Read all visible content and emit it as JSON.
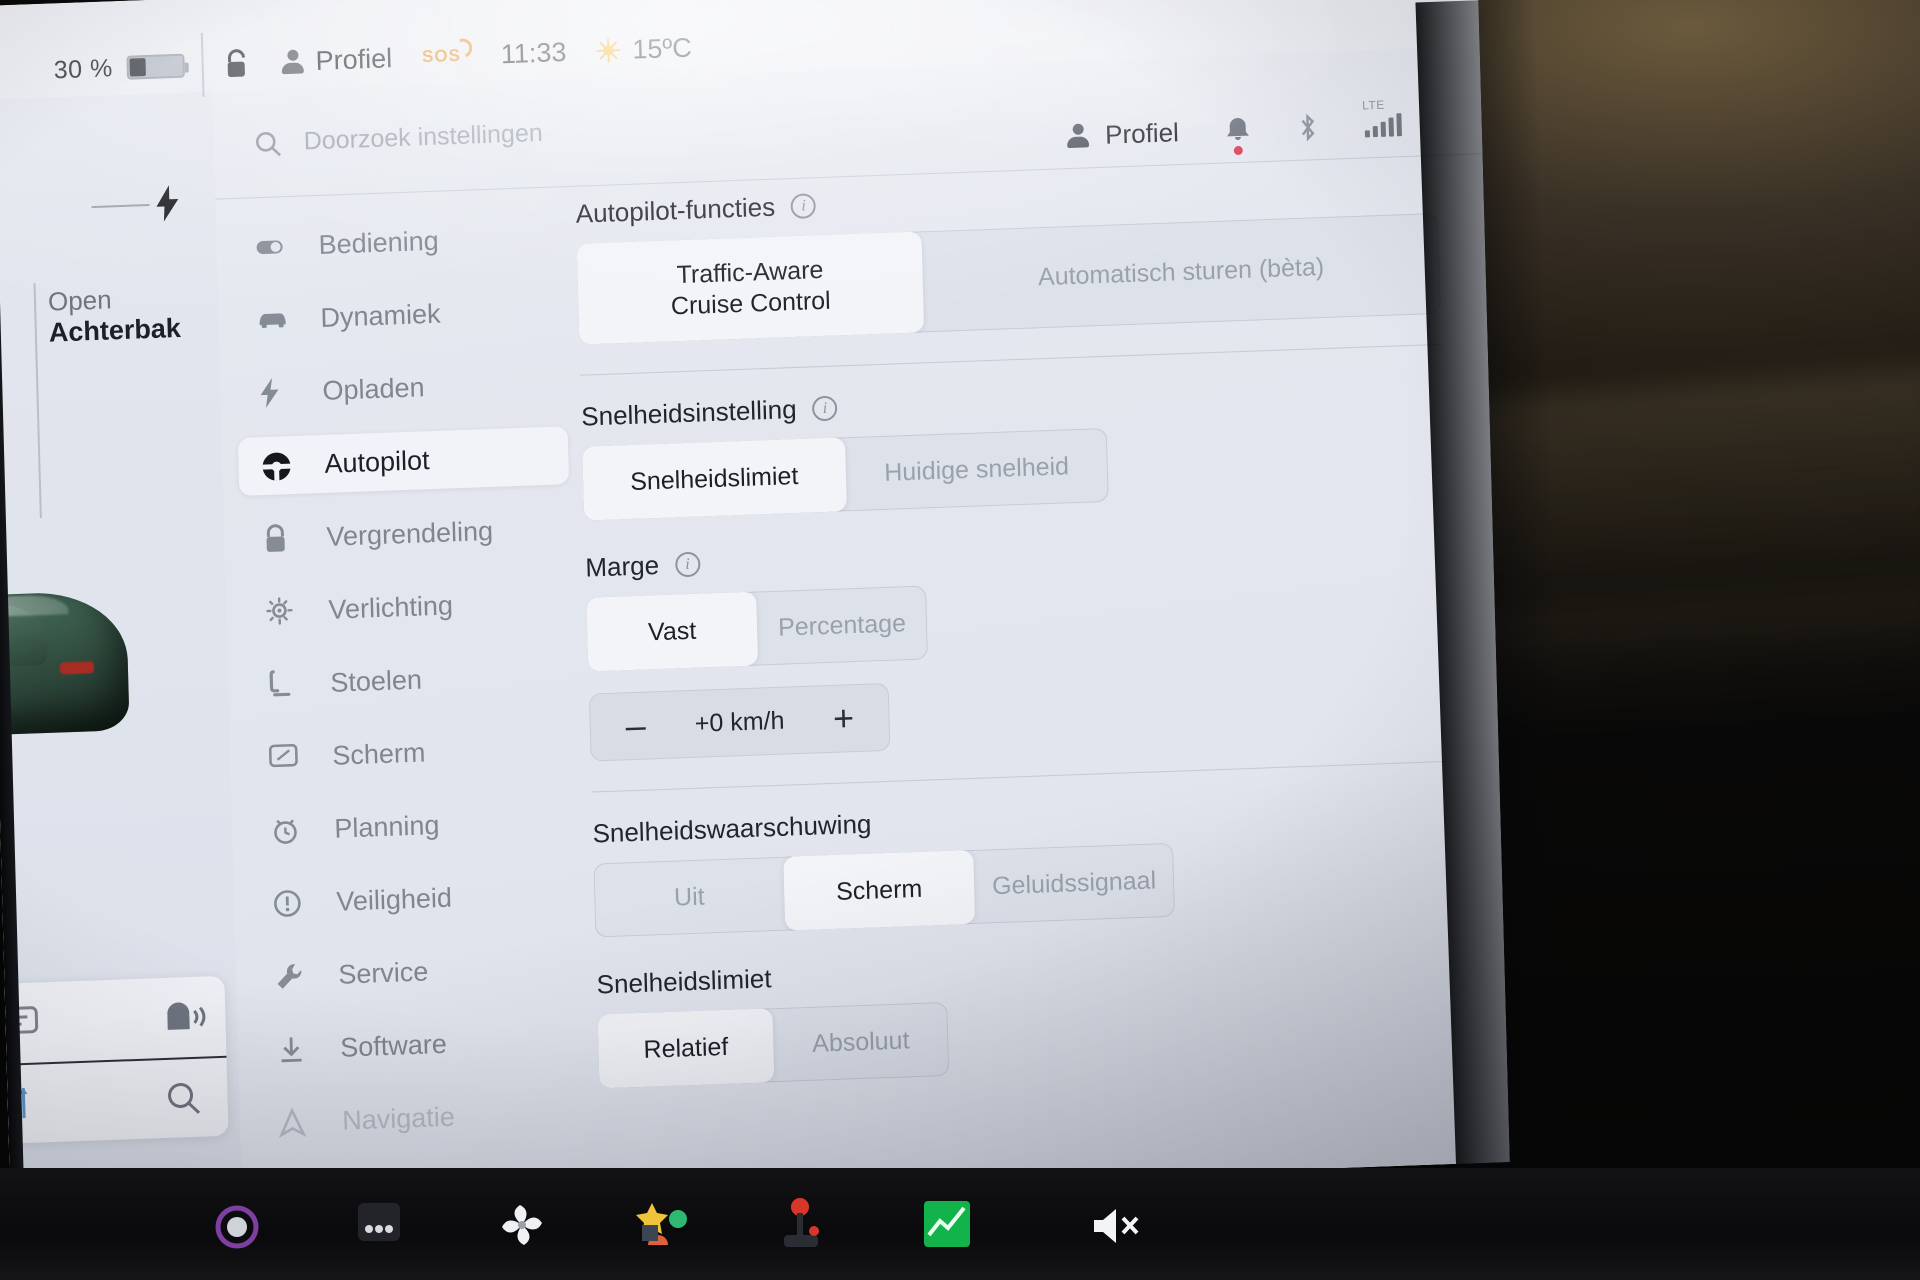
{
  "statusbar": {
    "battery_percent": "30 %",
    "battery_level": 30,
    "lock_icon": "unlock-icon",
    "profile_label": "Profiel",
    "sos_label": "SOS",
    "time": "11:33",
    "weather_icon": "sun-icon",
    "temperature": "15ºC"
  },
  "left_panel": {
    "action_line1": "Open",
    "action_line2": "Achterbak",
    "car_icon": "tesla-car-render",
    "charge_icon": "lightning-bolt-icon",
    "card": {
      "voice_icon": "voice-assistant-icon",
      "list_icon": "list-icon",
      "search_icon": "search-icon",
      "slider_icon": "slider-icon"
    }
  },
  "settings": {
    "search": {
      "placeholder": "Doorzoek instellingen",
      "value": "",
      "icon": "search-icon"
    },
    "topbar": {
      "profile_label": "Profiel",
      "profile_icon": "person-icon",
      "bell_icon": "bell-icon",
      "bell_has_badge": true,
      "bluetooth_icon": "bluetooth-icon",
      "network_label": "LTE",
      "network_icon": "signal-bars-icon"
    },
    "nav": {
      "items": [
        {
          "label": "Bediening",
          "icon": "toggle-icon",
          "selected": false
        },
        {
          "label": "Dynamiek",
          "icon": "car-icon",
          "selected": false
        },
        {
          "label": "Opladen",
          "icon": "lightning-icon",
          "selected": false
        },
        {
          "label": "Autopilot",
          "icon": "steering-wheel-icon",
          "selected": true
        },
        {
          "label": "Vergrendeling",
          "icon": "lock-icon",
          "selected": false
        },
        {
          "label": "Verlichting",
          "icon": "bulb-icon",
          "selected": false
        },
        {
          "label": "Stoelen",
          "icon": "seat-icon",
          "selected": false
        },
        {
          "label": "Scherm",
          "icon": "display-icon",
          "selected": false
        },
        {
          "label": "Planning",
          "icon": "clock-icon",
          "selected": false
        },
        {
          "label": "Veiligheid",
          "icon": "warning-icon",
          "selected": false
        },
        {
          "label": "Service",
          "icon": "wrench-icon",
          "selected": false
        },
        {
          "label": "Software",
          "icon": "download-icon",
          "selected": false
        },
        {
          "label": "Navigatie",
          "icon": "navigation-icon",
          "selected": false
        }
      ]
    },
    "sections": {
      "autopilot_functions": {
        "title": "Autopilot-functies",
        "has_info": true,
        "options": [
          "Traffic-Aware\nCruise Control",
          "Automatisch sturen (bèta)"
        ],
        "option1": "Traffic-Aware Cruise Control",
        "option1_line1": "Traffic-Aware",
        "option1_line2": "Cruise Control",
        "option2": "Automatisch sturen (bèta)",
        "selected": 0
      },
      "speed_setting": {
        "title": "Snelheidsinstelling",
        "has_info": true,
        "option1": "Snelheidslimiet",
        "option2": "Huidige snelheid",
        "selected": 0
      },
      "margin": {
        "title": "Marge",
        "has_info": true,
        "option1": "Vast",
        "option2": "Percentage",
        "selected": 0,
        "stepper": {
          "minus": "–",
          "value": "+0 km/h",
          "plus": "+"
        }
      },
      "speed_warning": {
        "title": "Snelheidswaarschuwing",
        "has_info": false,
        "option1": "Uit",
        "option2": "Scherm",
        "option3": "Geluidssignaal",
        "selected": 1
      },
      "speed_limit": {
        "title": "Snelheidslimiet",
        "has_info": false,
        "option1": "Relatief",
        "option2": "Absoluut",
        "selected": 0
      }
    }
  },
  "taskbar": {
    "mute_icon": "speaker-muted-icon",
    "icons": [
      {
        "name": "purple-orb-icon"
      },
      {
        "name": "grid-dots-icon"
      },
      {
        "name": "fan-icon"
      },
      {
        "name": "shapes-icon"
      },
      {
        "name": "joystick-icon"
      },
      {
        "name": "chart-icon"
      }
    ]
  },
  "colors": {
    "accent_orange": "#e8902e",
    "badge_red": "#e0405a",
    "car_green": "#3f6252",
    "panel_bg": "#e3e6ee",
    "selected_bg": "#f2f4f8"
  }
}
